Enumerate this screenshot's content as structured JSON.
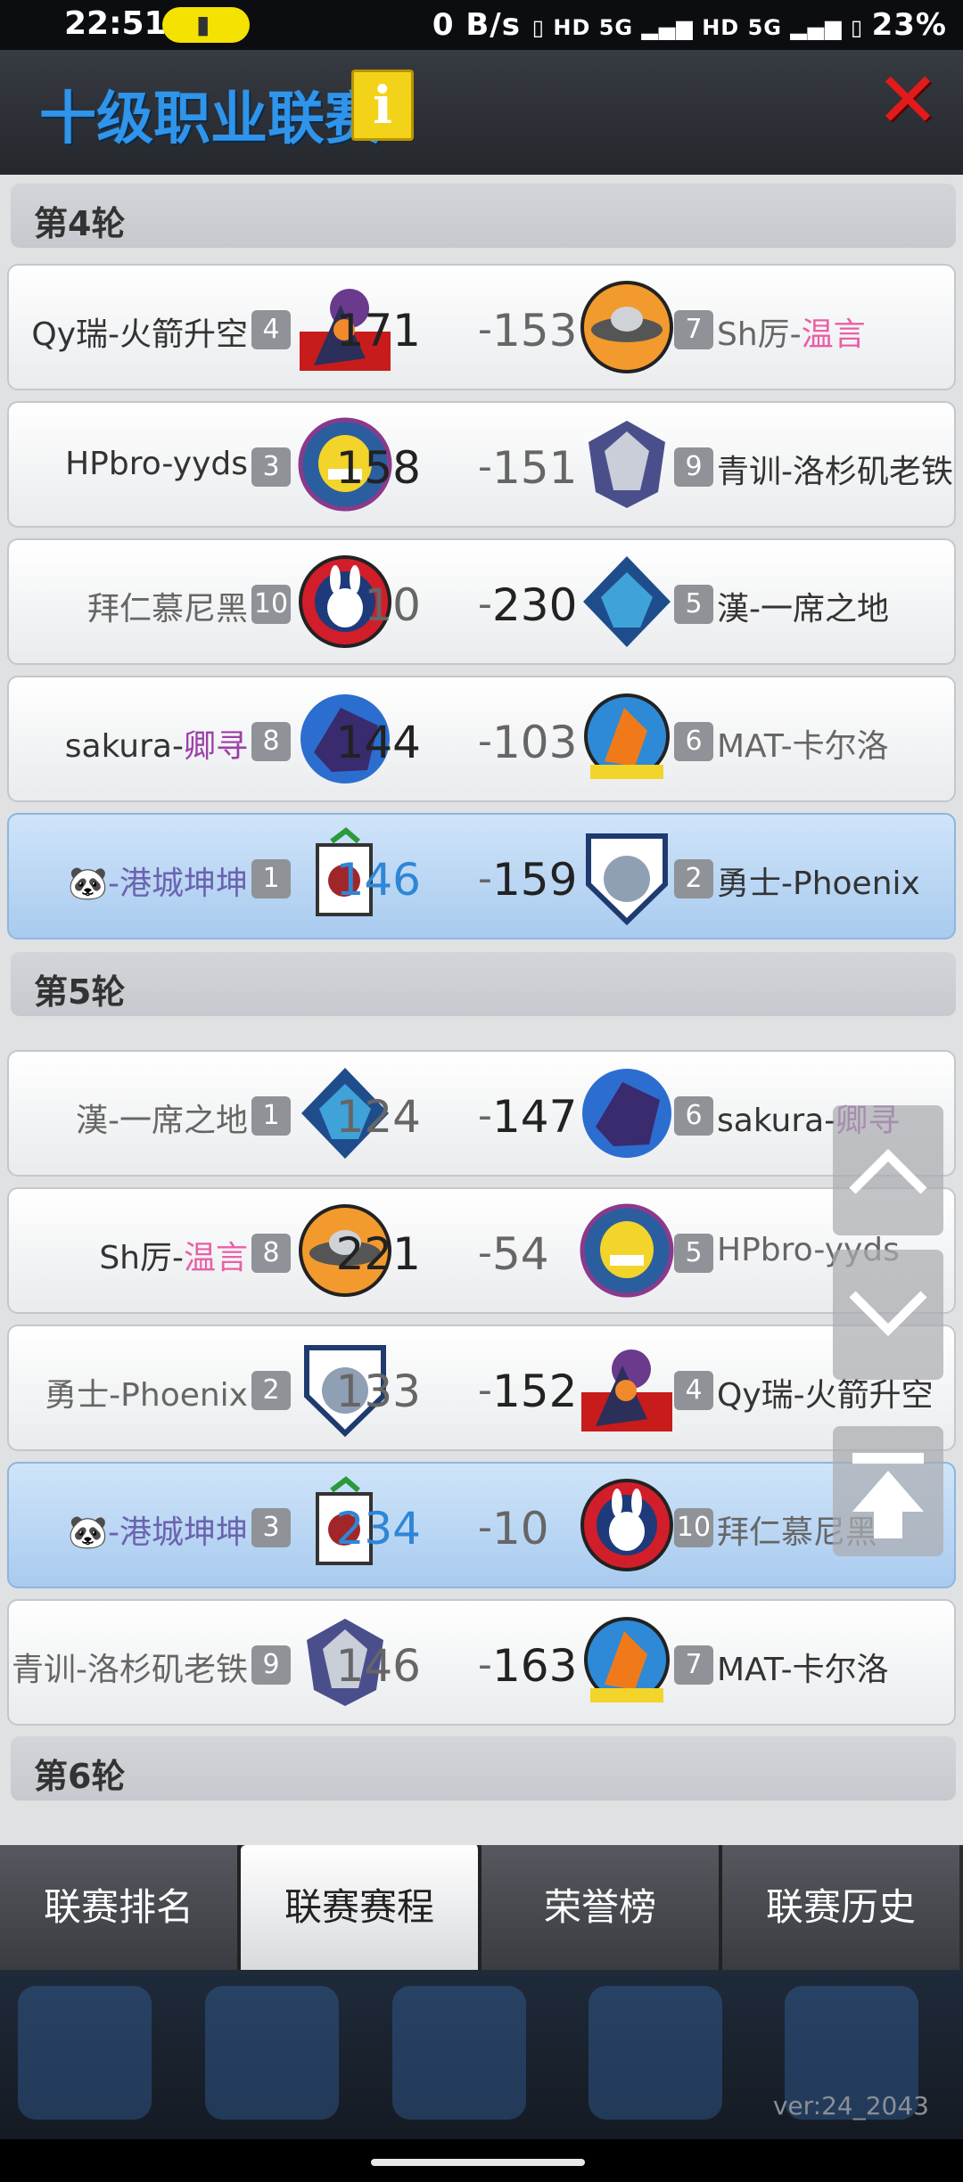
{
  "status_bar": {
    "time": "22:51",
    "network_speed": "0 B/s",
    "signal_text": "HD 5G HD 5G",
    "battery": "23%"
  },
  "header": {
    "title": "十级职业联赛",
    "info_icon": "info-icon",
    "close_icon": "close-icon"
  },
  "rounds": [
    {
      "label": "第4轮"
    },
    {
      "label": "第5轮"
    },
    {
      "label": "第6轮"
    }
  ],
  "matches": [
    {
      "home": "Qy瑞-火箭升空",
      "home_rank": "4",
      "home_score": "171",
      "away_score": "153",
      "away_rank": "7",
      "away_prefix": "Sh厉-",
      "away_suffix": "温言"
    },
    {
      "home": "HPbro-yyds",
      "home_rank": "3",
      "home_score": "158",
      "away_score": "151",
      "away_rank": "9",
      "away": "青训-洛杉矶老铁"
    },
    {
      "home": "拜仁慕尼黑",
      "home_rank": "10",
      "home_score": "10",
      "away_score": "230",
      "away_rank": "5",
      "away": "漢-一席之地"
    },
    {
      "home_prefix": "sakura-",
      "home_suffix": "卿寻",
      "home_rank": "8",
      "home_score": "144",
      "away_score": "103",
      "away_rank": "6",
      "away": "MAT-卡尔洛"
    },
    {
      "home": "🐼-港城坤坤",
      "home_rank": "1",
      "home_score": "146",
      "away_score": "159",
      "away_rank": "2",
      "away": "勇士-Phoenix"
    },
    {
      "home": "漢-一席之地",
      "home_rank": "1",
      "home_score": "124",
      "away_score": "147",
      "away_rank": "6",
      "away_prefix": "sakura-",
      "away_suffix": "卿寻"
    },
    {
      "home_prefix": "Sh厉-",
      "home_suffix": "温言",
      "home_rank": "8",
      "home_score": "221",
      "away_score": "54",
      "away_rank": "5",
      "away": "HPbro-yyds"
    },
    {
      "home": "勇士-Phoenix",
      "home_rank": "2",
      "home_score": "133",
      "away_score": "152",
      "away_rank": "4",
      "away": "Qy瑞-火箭升空"
    },
    {
      "home": "🐼-港城坤坤",
      "home_rank": "3",
      "home_score": "234",
      "away_score": "10",
      "away_rank": "10",
      "away": "拜仁慕尼黑"
    },
    {
      "home": "青训-洛杉矶老铁",
      "home_rank": "9",
      "home_score": "146",
      "away_score": "163",
      "away_rank": "7",
      "away": "MAT-卡尔洛"
    }
  ],
  "score_separator": "-",
  "tabs": [
    {
      "label": "联赛排名"
    },
    {
      "label": "联赛赛程",
      "active": true
    },
    {
      "label": "荣誉榜"
    },
    {
      "label": "联赛历史"
    }
  ],
  "version": "ver:24_2043",
  "colors": {
    "title": "#2f94ea",
    "highlight_row": "#b9d6f3",
    "score_blue": "#2e86d6",
    "pink_name": "#e95fa5",
    "purple_name": "#9b3fa8"
  }
}
